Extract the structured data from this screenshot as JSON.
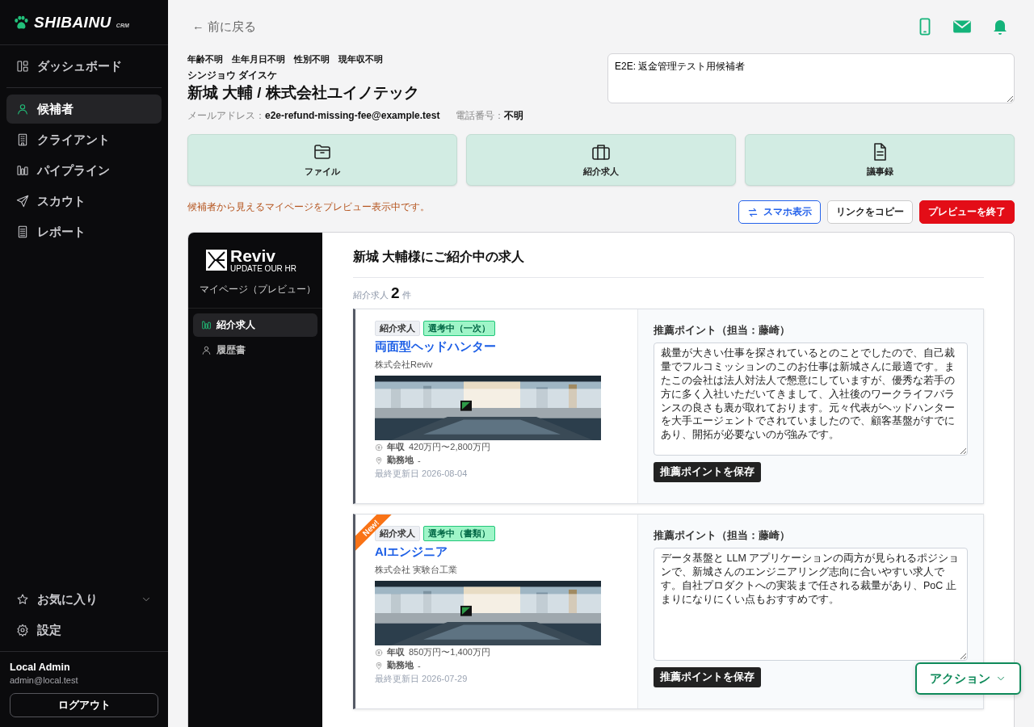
{
  "sidebar": {
    "logo": "SHIBAINU",
    "logo_sub": "CRM",
    "items": [
      {
        "label": "ダッシュボード",
        "selected": false
      },
      {
        "label": "候補者",
        "selected": true
      },
      {
        "label": "クライアント",
        "selected": false
      },
      {
        "label": "パイプライン",
        "selected": false
      },
      {
        "label": "スカウト",
        "selected": false
      },
      {
        "label": "レポート",
        "selected": false
      }
    ],
    "favorites": {
      "label": "お気に入り",
      "expanded": false
    },
    "settings": "設定",
    "user": {
      "name": "Local Admin",
      "email": "admin@local.test"
    },
    "logout": "ログアウト"
  },
  "header": {
    "back_arrow": "←",
    "back": "前に戻る"
  },
  "profile": {
    "attributes": [
      "年齢不明",
      "生年月日不明",
      "性別不明",
      "現年収不明"
    ],
    "kana": "シンジョウ ダイスケ",
    "name": "新城 大輔 / 株式会社ユイノテック",
    "email_label": "メールアドレス：",
    "email": "e2e-refund-missing-fee@example.test",
    "phone_label": "電話番号：",
    "phone": "不明"
  },
  "memo": {
    "value": "E2E: 返金管理テスト用候補者"
  },
  "quick_actions": [
    {
      "label": "ファイル"
    },
    {
      "label": "紹介求人"
    },
    {
      "label": "議事録"
    }
  ],
  "preview_notice": "候補者から見えるマイページをプレビュー表示中です。",
  "preview_buttons": [
    {
      "label": "スマホ表示",
      "kind": "outline-blue"
    },
    {
      "label": "リンクをコピー",
      "kind": "outline"
    },
    {
      "label": "プレビューを終了",
      "kind": "danger"
    }
  ],
  "preview": {
    "brand": "Reviv",
    "brand_sub": "UPDATE OUR HR",
    "subtitle": "マイページ（プレビュー）",
    "nav": [
      {
        "label": "紹介求人",
        "selected": true
      },
      {
        "label": "履歴書",
        "selected": false
      }
    ],
    "heading": "新城 大輔様にご紹介中の求人",
    "count_label": "紹介求人",
    "count": "2",
    "count_unit": "件",
    "jobs": [
      {
        "is_new": false,
        "tags": [
          {
            "label": "紹介求人",
            "kind": "plain"
          },
          {
            "label": "選考中（一次）",
            "kind": "status"
          }
        ],
        "title": "両面型ヘッドハンター",
        "company": "株式会社Reviv",
        "salary_label": "年収",
        "salary": "420万円〜2,800万円",
        "location_label": "勤務地",
        "location": "-",
        "updated": "最終更新日 2026-08-04",
        "rec_label": "推薦ポイント（担当：藤崎）",
        "rec_text": "裁量が大きい仕事を探されているとのことでしたので、自己裁量でフルコミッションのこのお仕事は新城さんに最適です。またこの会社は法人対法人で懇意にしていますが、優秀な若手の方に多く入社いただいてきまして、入社後のワークライフバランスの良さも裏が取れております。元々代表がヘッドハンターを大手エージェントでされていましたので、顧客基盤がすでにあり、開拓が必要ないのが強みです。",
        "save": "推薦ポイントを保存"
      },
      {
        "is_new": true,
        "new_label": "New!",
        "tags": [
          {
            "label": "紹介求人",
            "kind": "plain"
          },
          {
            "label": "選考中（書類）",
            "kind": "status"
          }
        ],
        "title": "AIエンジニア",
        "company": "株式会社 実験台工業",
        "salary_label": "年収",
        "salary": "850万円〜1,400万円",
        "location_label": "勤務地",
        "location": "-",
        "updated": "最終更新日 2026-07-29",
        "rec_label": "推薦ポイント（担当：藤崎）",
        "rec_text": "データ基盤と LLM アプリケーションの両方が見られるポジションで、新城さんのエンジニアリング志向に合いやすい求人です。自社プロダクトへの実装まで任される裁量があり、PoC 止まりになりにくい点もおすすめです。",
        "save": "推薦ポイントを保存"
      }
    ]
  },
  "action_button": "アクション"
}
